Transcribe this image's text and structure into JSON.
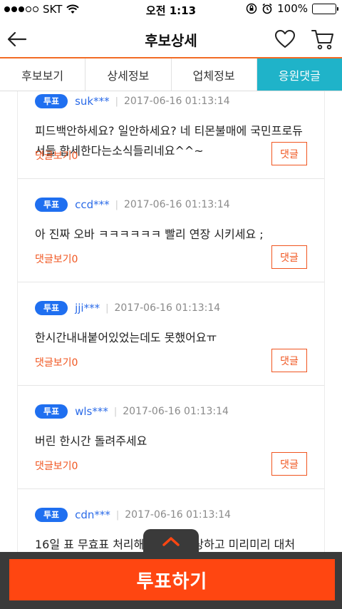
{
  "status_bar": {
    "carrier": "SKT",
    "time": "오전 1:13",
    "battery": "100%"
  },
  "header": {
    "title": "후보상세",
    "back_icon": "back-arrow-icon",
    "favorite_icon": "heart-icon",
    "cart_icon": "cart-icon"
  },
  "tabs": [
    {
      "label": "후보보기",
      "active": false
    },
    {
      "label": "상세정보",
      "active": false
    },
    {
      "label": "업체정보",
      "active": false
    },
    {
      "label": "응원댓글",
      "active": true
    }
  ],
  "comments": [
    {
      "badge": "투표",
      "user": "suk***",
      "date": "2017-06-16 01:13:14",
      "text": "피드백안하세요? 일안하세요? 네 티몬불매에 국민프로듀서들 합세한다는소식들리네요^^~",
      "reply_link": "댓글보기0",
      "reply_button": "댓글"
    },
    {
      "badge": "투표",
      "user": "ccd***",
      "date": "2017-06-16 01:13:14",
      "text": "아 진짜 오바 ㅋㅋㅋㅋㅋㅋ 빨리 연장 시키세요 ;",
      "reply_link": "댓글보기0",
      "reply_button": "댓글"
    },
    {
      "badge": "투표",
      "user": "jji***",
      "date": "2017-06-16 01:13:14",
      "text": "한시간내내붙어있었는데도 못했어요ㅠ",
      "reply_link": "댓글보기0",
      "reply_button": "댓글"
    },
    {
      "badge": "투표",
      "user": "wls***",
      "date": "2017-06-16 01:13:14",
      "text": "버린 한시간 돌려주세요",
      "reply_link": "댓글보기0",
      "reply_button": "댓글"
    },
    {
      "badge": "투표",
      "user": "cdn***",
      "date": "2017-06-16 01:13:14",
      "text": "16일 표 무효표 처리해라 사태 예상하고 미리미리 대처",
      "reply_link": "",
      "reply_button": ""
    }
  ],
  "bottom": {
    "vote_button": "투표하기",
    "pull_icon": "chevron-up-icon"
  },
  "colors": {
    "accent": "#f26b24",
    "active_tab": "#1fb3c9",
    "badge": "#1f6ff0",
    "vote_button": "#ff4611"
  }
}
